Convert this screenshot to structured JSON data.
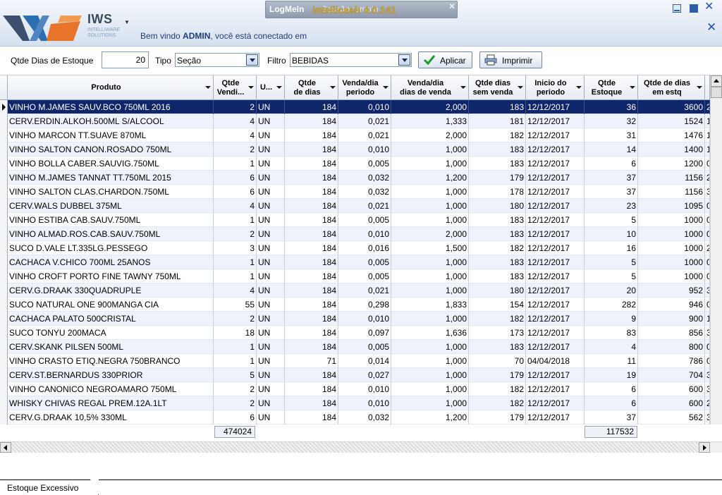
{
  "header": {
    "logo_main": "IWS",
    "logo_sub1": "INTELLIWARE",
    "logo_sub2": "SOLUTIONS",
    "welcome_prefix": "Bem vindo ",
    "welcome_user": "ADMIN",
    "welcome_suffix": ", você está conectado em",
    "logmein_brand": "LogMeIn",
    "logmein_session": "Sessão remota",
    "app_title": "intellicash 4.0.141"
  },
  "toolbar": {
    "dias_label": "Qtde Dias de Estoque",
    "dias_value": "20",
    "tipo_label": "Tipo",
    "tipo_value": "Seção",
    "filtro_label": "Filtro",
    "filtro_value": "BEBIDAS",
    "aplicar_label": "Aplicar",
    "imprimir_label": "Imprimir"
  },
  "table": {
    "columns": [
      {
        "line1": "Produto",
        "line2": ""
      },
      {
        "line1": "Qtde",
        "line2": "Vendi..."
      },
      {
        "line1": "U...",
        "line2": ""
      },
      {
        "line1": "Qtde",
        "line2": "de dias"
      },
      {
        "line1": "Venda/dia",
        "line2": "periodo"
      },
      {
        "line1": "Venda/dia",
        "line2": "dias de venda"
      },
      {
        "line1": "Qtde dias",
        "line2": "sem venda"
      },
      {
        "line1": "Inicio do",
        "line2": "periodo"
      },
      {
        "line1": "Qtde",
        "line2": "Estoque"
      },
      {
        "line1": "Qtde de dias",
        "line2": "em estq"
      }
    ],
    "rows": [
      [
        "VINHO M.JAMES SAUV.BCO 750ML 2016",
        "2",
        "UN",
        "184",
        "0,010",
        "2,000",
        "183",
        "12/12/2017",
        "36",
        "3600",
        "2"
      ],
      [
        "CERV.ERDIN.ALKOH.500ML S/ALCOOL",
        "4",
        "UN",
        "184",
        "0,021",
        "1,333",
        "181",
        "12/12/2017",
        "32",
        "1524",
        "1"
      ],
      [
        "VINHO MARCON TT.SUAVE 870ML",
        "4",
        "UN",
        "184",
        "0,021",
        "2,000",
        "182",
        "12/12/2017",
        "31",
        "1476",
        "1"
      ],
      [
        "VINHO SALTON CANON.ROSADO 750ML",
        "2",
        "UN",
        "184",
        "0,010",
        "1,000",
        "183",
        "12/12/2017",
        "14",
        "1400",
        "1"
      ],
      [
        "VINHO BOLLA CABER.SAUVIG.750ML",
        "1",
        "UN",
        "184",
        "0,005",
        "1,000",
        "183",
        "12/12/2017",
        "6",
        "1200",
        "0"
      ],
      [
        "VINHO M.JAMES TANNAT TT.750ML 2015",
        "6",
        "UN",
        "184",
        "0,032",
        "1,200",
        "179",
        "12/12/2017",
        "37",
        "1156",
        "2"
      ],
      [
        "VINHO SALTON CLAS.CHARDON.750ML",
        "6",
        "UN",
        "184",
        "0,032",
        "1,000",
        "178",
        "12/12/2017",
        "37",
        "1156",
        "3"
      ],
      [
        "CERV.WALS DUBBEL 375ML",
        "4",
        "UN",
        "184",
        "0,021",
        "1,000",
        "180",
        "12/12/2017",
        "23",
        "1095",
        "0"
      ],
      [
        "VINHO ESTIBA CAB.SAUV.750ML",
        "1",
        "UN",
        "184",
        "0,005",
        "1,000",
        "183",
        "12/12/2017",
        "5",
        "1000",
        "0"
      ],
      [
        "VINHO ALMAD.ROS.CAB.SAUV.750ML",
        "2",
        "UN",
        "184",
        "0,010",
        "2,000",
        "183",
        "12/12/2017",
        "10",
        "1000",
        "0"
      ],
      [
        "SUCO D.VALE LT.335LG.PESSEGO",
        "3",
        "UN",
        "184",
        "0,016",
        "1,500",
        "182",
        "12/12/2017",
        "16",
        "1000",
        "2"
      ],
      [
        "CACHACA V.CHICO 700ML 25ANOS",
        "1",
        "UN",
        "184",
        "0,005",
        "1,000",
        "183",
        "12/12/2017",
        "5",
        "1000",
        "0"
      ],
      [
        "VINHO CROFT PORTO FINE TAWNY 750ML",
        "1",
        "UN",
        "184",
        "0,005",
        "1,000",
        "183",
        "12/12/2017",
        "5",
        "1000",
        "0"
      ],
      [
        "CERV.G.DRAAK 330QUADRUPLE",
        "4",
        "UN",
        "184",
        "0,021",
        "1,000",
        "180",
        "12/12/2017",
        "20",
        "952",
        "3"
      ],
      [
        "SUCO NATURAL ONE 900MANGA CIA",
        "55",
        "UN",
        "184",
        "0,298",
        "1,833",
        "154",
        "12/12/2017",
        "282",
        "946",
        "0"
      ],
      [
        "CACHACA PALATO 500CRISTAL",
        "2",
        "UN",
        "184",
        "0,010",
        "1,000",
        "182",
        "12/12/2017",
        "9",
        "900",
        "1"
      ],
      [
        "SUCO TONYU 200MACA",
        "18",
        "UN",
        "184",
        "0,097",
        "1,636",
        "173",
        "12/12/2017",
        "83",
        "856",
        "3"
      ],
      [
        "CERV.SKANK PILSEN 500ML",
        "1",
        "UN",
        "184",
        "0,005",
        "1,000",
        "183",
        "12/12/2017",
        "4",
        "800",
        "0"
      ],
      [
        "VINHO CRASTO ETIQ.NEGRA 750BRANCO",
        "1",
        "UN",
        "71",
        "0,014",
        "1,000",
        "70",
        "04/04/2018",
        "11",
        "786",
        "0"
      ],
      [
        "CERV.ST.BERNARDUS 330PRIOR",
        "5",
        "UN",
        "184",
        "0,027",
        "1,000",
        "179",
        "12/12/2017",
        "19",
        "704",
        "3"
      ],
      [
        "VINHO CANONICO NEGROAMARO 750ML",
        "2",
        "UN",
        "184",
        "0,010",
        "1,000",
        "182",
        "12/12/2017",
        "6",
        "600",
        "3"
      ],
      [
        "WHISKY CHIVAS REGAL PREM.12A.1LT",
        "2",
        "UN",
        "184",
        "0,010",
        "1,000",
        "182",
        "12/12/2017",
        "6",
        "600",
        "2"
      ],
      [
        "CERV.G.DRAAK 10,5% 330ML",
        "6",
        "UN",
        "184",
        "0,032",
        "1,200",
        "179",
        "12/12/2017",
        "37",
        "562",
        "3"
      ]
    ],
    "sum_vendida": "474024",
    "sum_estoque": "117532"
  },
  "tabs": {
    "active_label": "Estoque Excessivo"
  },
  "colors": {
    "selected_row": "#10266a",
    "alt_row": "#eef2fa",
    "accent_blue": "#1e56b0",
    "app_title_gold": "#c8a236"
  }
}
